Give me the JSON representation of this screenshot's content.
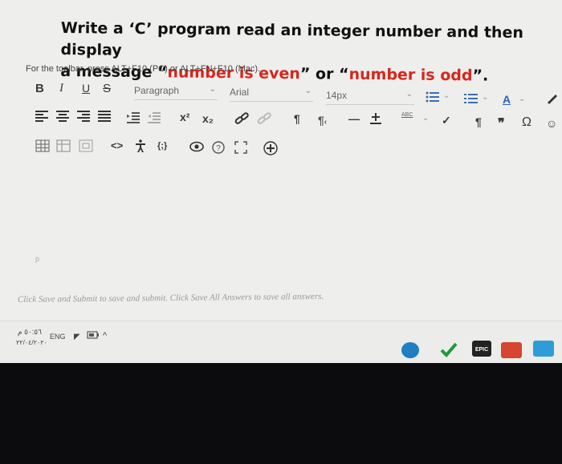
{
  "question": {
    "line1": "Write a ‘C’ program read an integer number and then display",
    "line2_pre": "a message “",
    "line2_even": "number is even",
    "line2_mid": "” or “",
    "line2_odd": "number is odd",
    "line2_post": "”."
  },
  "toolbar_hint": "For the toolbar, press ALT+F10 (PC) or ALT+FN+F10 (Mac).",
  "toolbar": {
    "bold": "B",
    "italic": "I",
    "underline": "U",
    "strike": "S",
    "paragraph": "Paragraph",
    "font": "Arial",
    "size": "14px",
    "code": "<>",
    "json": "{;}",
    "spellcheck": "ABC",
    "quote": "❞",
    "omega": "Ω",
    "superscript": "x²",
    "subscript": "x₂"
  },
  "editor": {
    "path": "p",
    "submit_hint": "Click Save and Submit to save and submit. Click Save All Answers to save all answers."
  },
  "taskbar": {
    "time": "٥٠:٥٦ م",
    "date": "٢٢/٠٤/٢٠٢٠",
    "language": "ENG",
    "chevron": "^"
  },
  "colors": {
    "red_text": "#d8261c",
    "page_bg": "#eeeeec",
    "desk_bg": "#0c0c0e"
  }
}
